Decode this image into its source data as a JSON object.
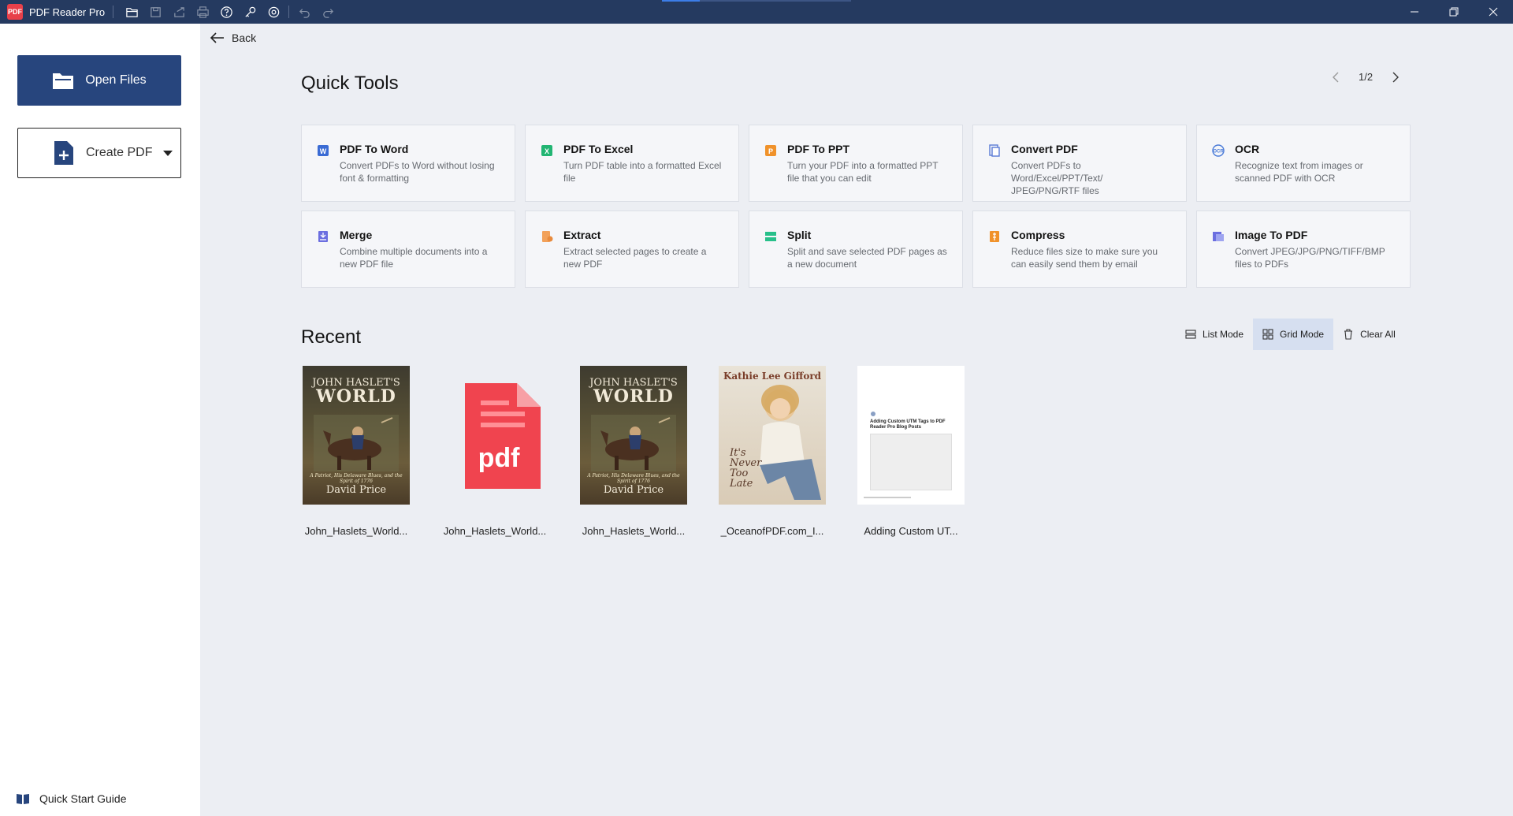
{
  "app": {
    "title": "PDF Reader Pro",
    "logo_text": "PDF"
  },
  "toolbar": {
    "icons": [
      "open-folder-icon",
      "save-icon",
      "share-icon",
      "print-icon",
      "help-icon",
      "key-icon",
      "settings-icon",
      "undo-icon",
      "redo-icon"
    ]
  },
  "title_progress": 0.2,
  "window_controls": [
    "minimize-icon",
    "restore-icon",
    "close-icon"
  ],
  "sidebar": {
    "open_files_label": "Open Files",
    "create_pdf_label": "Create PDF",
    "quick_start_label": "Quick Start Guide"
  },
  "back_label": "Back",
  "quick_tools": {
    "title": "Quick Tools",
    "page_indicator": "1/2",
    "tools": [
      {
        "name": "PDF To Word",
        "desc": "Convert PDFs to Word without losing font & formatting",
        "icon": "word-icon",
        "color": "#3a6bd4"
      },
      {
        "name": "PDF To Excel",
        "desc": "Turn PDF table into a formatted Excel file",
        "icon": "excel-icon",
        "color": "#22b573"
      },
      {
        "name": "PDF To PPT",
        "desc": "Turn your PDF into a formatted PPT file that you can edit",
        "icon": "ppt-icon",
        "color": "#f0922b"
      },
      {
        "name": "Convert PDF",
        "desc": "Convert PDFs to Word/Excel/PPT/Text/ JPEG/PNG/RTF files",
        "icon": "convert-icon",
        "color": "#5b7bd6"
      },
      {
        "name": "OCR",
        "desc": "Recognize text from images or scanned PDF with OCR",
        "icon": "ocr-icon",
        "color": "#4a7bd8"
      },
      {
        "name": "Merge",
        "desc": "Combine multiple documents into a new PDF file",
        "icon": "merge-icon",
        "color": "#6b6ee0"
      },
      {
        "name": "Extract",
        "desc": "Extract selected pages to create a new PDF",
        "icon": "extract-icon",
        "color": "#f2a15a"
      },
      {
        "name": "Split",
        "desc": "Split and save selected PDF pages as a new document",
        "icon": "split-icon",
        "color": "#27c08a"
      },
      {
        "name": "Compress",
        "desc": "Reduce files size to make sure you can easily send them by email",
        "icon": "compress-icon",
        "color": "#f0922b"
      },
      {
        "name": "Image To PDF",
        "desc": "Convert JPEG/JPG/PNG/TIFF/BMP files to PDFs",
        "icon": "image-icon",
        "color": "#6b6ee0"
      }
    ]
  },
  "recent": {
    "title": "Recent",
    "list_mode_label": "List Mode",
    "grid_mode_label": "Grid Mode",
    "clear_all_label": "Clear All",
    "files": [
      {
        "name": "John_Haslets_World...",
        "thumb": "cover"
      },
      {
        "name": "John_Haslets_World...",
        "thumb": "pdf"
      },
      {
        "name": "John_Haslets_World...",
        "thumb": "cover"
      },
      {
        "name": "_OceanofPDF.com_I...",
        "thumb": "kathie"
      },
      {
        "name": "Adding Custom UT...",
        "thumb": "doc"
      }
    ],
    "cover": {
      "title_line1": "JOHN HASLET'S",
      "title_line2": "WORLD",
      "subtitle": "A Patriot, His Delaware Blues, and the Spirit of 1776",
      "author": "David Price"
    },
    "kathie": {
      "name": "Kathie Lee Gifford",
      "tagline": "It's Never Too Late"
    },
    "doc": {
      "title": "Adding Custom UTM Tags to PDF Reader Pro Blog Posts"
    },
    "pdf_label": "pdf",
    "pdf_color": "#f0444f"
  }
}
